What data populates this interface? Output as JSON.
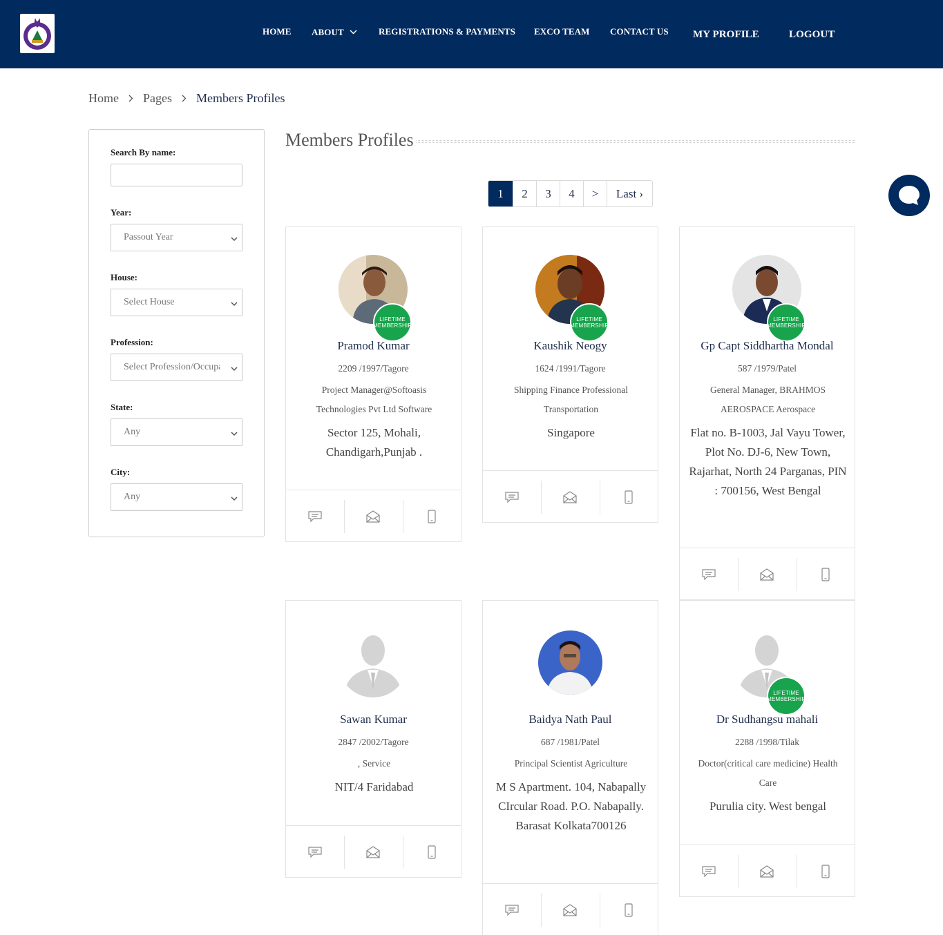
{
  "header": {
    "nav": [
      {
        "label": "HOME"
      },
      {
        "label": "ABOUT"
      },
      {
        "label": "REGISTRATIONS & PAYMENTS"
      },
      {
        "label": "EXCO TEAM"
      },
      {
        "label": "CONTACT US"
      },
      {
        "label": "MY PROFILE"
      },
      {
        "label": "LOGOUT"
      }
    ]
  },
  "breadcrumb": {
    "home": "Home",
    "pages": "Pages",
    "current": "Members Profiles"
  },
  "filters": {
    "search_label": "Search By name:",
    "search_value": "",
    "year_label": "Year:",
    "year_value": "Passout Year",
    "house_label": "House:",
    "house_value": "Select House",
    "profession_label": "Profession:",
    "profession_value": "Select Profession/Occupation",
    "state_label": "State:",
    "state_value": "Any",
    "city_label": "City:",
    "city_value": "Any"
  },
  "main": {
    "title": "Members Profiles"
  },
  "pagination": {
    "pages": [
      "1",
      "2",
      "3",
      "4",
      ">",
      "Last ›"
    ],
    "active": "1"
  },
  "badge": {
    "line1": "LIFETIME",
    "line2": "MEMBERSHIP"
  },
  "members": [
    {
      "name": "Pramod Kumar",
      "meta": "2209 /1997/Tagore",
      "profession": "Project Manager@Softoasis Technologies Pvt Ltd Software",
      "address": "Sector 125, Mohali, Chandigarh,Punjab .",
      "lifetime": true
    },
    {
      "name": "Kaushik Neogy",
      "meta": "1624 /1991/Tagore",
      "profession": "Shipping Finance Professional Transportation",
      "address": "Singapore",
      "lifetime": true
    },
    {
      "name": "Gp Capt Siddhartha Mondal",
      "meta": "587 /1979/Patel",
      "profession": "General Manager, BRAHMOS AEROSPACE Aerospace",
      "address": "Flat no. B-1003, Jal Vayu Tower, Plot No. DJ-6, New Town, Rajarhat, North 24 Parganas, PIN : 700156, West Bengal",
      "lifetime": true
    },
    {
      "name": "Sawan Kumar",
      "meta": "2847 /2002/Tagore",
      "profession": ", Service",
      "address": "NIT/4 Faridabad",
      "lifetime": false
    },
    {
      "name": "Baidya Nath Paul",
      "meta": "687 /1981/Patel",
      "profession": "Principal Scientist Agriculture",
      "address": "M S Apartment. 104, Nabapally CIrcular Road. P.O. Nabapally. Barasat Kolkata700126",
      "lifetime": false
    },
    {
      "name": "Dr Sudhangsu mahali",
      "meta": "2288 /1998/Tilak",
      "profession": "Doctor(critical care medicine) Health Care",
      "address": "Purulia city. West bengal",
      "lifetime": true
    }
  ],
  "icons": {
    "message": "message-icon",
    "email": "envelope-open-icon",
    "phone": "mobile-phone-icon",
    "chat": "chat-bubble-icon"
  },
  "colors": {
    "navy": "#012a5e",
    "badge_green": "#18a44c"
  }
}
